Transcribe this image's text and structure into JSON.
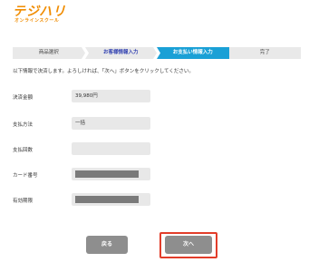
{
  "logo": {
    "main": "テジハリ",
    "sub": "オンラインスクール"
  },
  "steps": [
    {
      "label": "商品選択"
    },
    {
      "label": "お客様情報入力"
    },
    {
      "label": "お支払い情報入力"
    },
    {
      "label": "完了"
    }
  ],
  "intro_text": "以下情報で決済します。よろしければ、「次へ」ボタンをクリックしてください。",
  "fields": [
    {
      "label": "決済金額",
      "value": "39,980円"
    },
    {
      "label": "支払方法",
      "value": "一括"
    },
    {
      "label": "支払回数",
      "value": ""
    },
    {
      "label": "カード番号",
      "value": ""
    },
    {
      "label": "有効期限",
      "value": ""
    }
  ],
  "buttons": {
    "back": "戻る",
    "next": "次へ"
  },
  "colors": {
    "brand": "#f08c00",
    "current_step": "#1aa0d6",
    "highlight": "#e23d2a"
  }
}
